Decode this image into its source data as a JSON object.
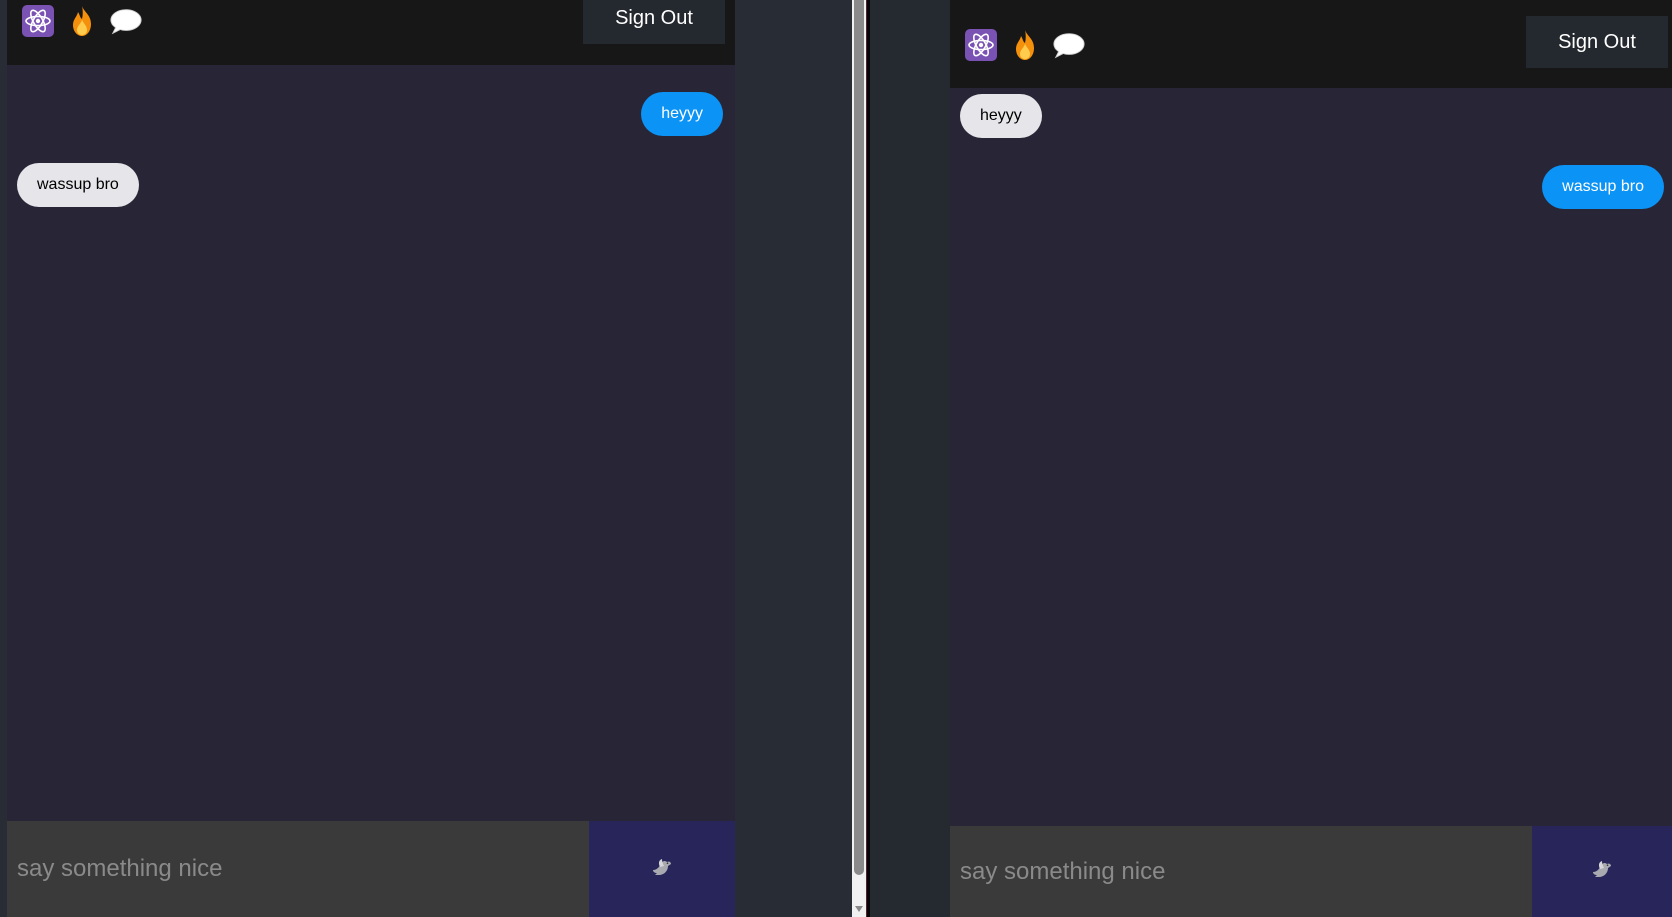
{
  "left_window": {
    "header": {
      "icons": [
        "react-atom-icon",
        "fire-icon",
        "speech-bubble-icon"
      ],
      "signout_label": "Sign Out"
    },
    "messages": [
      {
        "text": "heyyy",
        "type": "sent"
      },
      {
        "text": "wassup bro",
        "type": "received"
      }
    ],
    "composer": {
      "placeholder": "say something nice",
      "send_icon": "dove-icon"
    }
  },
  "right_window": {
    "header": {
      "icons": [
        "react-atom-icon",
        "fire-icon",
        "speech-bubble-icon"
      ],
      "signout_label": "Sign Out"
    },
    "messages": [
      {
        "text": "heyyy",
        "type": "received"
      },
      {
        "text": "wassup bro",
        "type": "sent"
      }
    ],
    "composer": {
      "placeholder": "say something nice",
      "send_icon": "dove-icon"
    }
  },
  "colors": {
    "sent_bubble": "#0b93f6",
    "received_bubble": "#e5e5ea",
    "header_bg": "#181717",
    "chat_bg": "#282636",
    "send_button_bg": "#27255a",
    "input_bg": "#3a3a3a"
  }
}
